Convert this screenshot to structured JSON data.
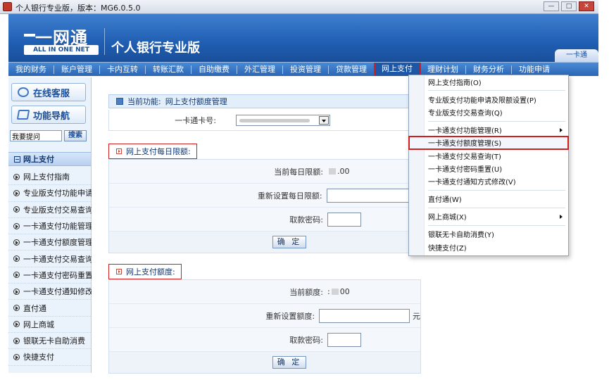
{
  "window": {
    "title": "个人银行专业版，版本：MG6.0.5.0",
    "controls": [
      "—",
      "□",
      "✕"
    ]
  },
  "header": {
    "logo_cn": "一网通",
    "logo_en": "ALL IN ONE NET",
    "product_name": "个人银行专业版",
    "shortcut_tab": "一卡通"
  },
  "nav": {
    "items": [
      "我的财务",
      "账户管理",
      "卡内互转",
      "转账汇款",
      "自助缴费",
      "外汇管理",
      "投资管理",
      "贷款管理",
      "网上支付",
      "理财计划",
      "财务分析",
      "功能申请"
    ],
    "active_index": 8
  },
  "sidebar": {
    "online_service": "在线客服",
    "function_nav": "功能导航",
    "search_placeholder": "我要提问",
    "search_button": "搜索",
    "section_title": "网上支付",
    "section_toggle": "−",
    "items": [
      "网上支付指南",
      "专业版支付功能申请",
      "专业版支付交易查询",
      "一卡通支付功能管理",
      "一卡通支付额度管理",
      "一卡通支付交易查询",
      "一卡通支付密码重置",
      "一卡通支付通知修改",
      "直付通",
      "网上商城",
      "银联无卡自助消费",
      "快捷支付"
    ]
  },
  "main": {
    "breadcrumb_label": "当前功能:",
    "breadcrumb_value": "网上支付额度管理",
    "card_label": "一卡通卡号:",
    "daily": {
      "title": "网上支付每日限额:",
      "current_label": "当前每日限额:",
      "current_prefix": "",
      "current_value": ".00",
      "reset_label": "重新设置每日限额:",
      "password_label": "取款密码:",
      "confirm": "确 定"
    },
    "quota": {
      "title": "网上支付额度:",
      "current_label": "当前额度:",
      "current_prefix": ":",
      "current_value": "00",
      "reset_label": "重新设置额度:",
      "unit": "元",
      "password_label": "取款密码:",
      "confirm": "确 定"
    }
  },
  "menu": {
    "groups": [
      [
        {
          "label": "网上支付指南(O)"
        }
      ],
      [
        {
          "label": "专业版支付功能申请及限额设置(P)"
        },
        {
          "label": "专业版支付交易查询(Q)"
        }
      ],
      [
        {
          "label": "一卡通支付功能管理(R)",
          "submenu": true
        },
        {
          "label": "一卡通支付额度管理(S)",
          "highlight": true
        },
        {
          "label": "一卡通支付交易查询(T)"
        },
        {
          "label": "一卡通支付密码重置(U)"
        },
        {
          "label": "一卡通支付通知方式修改(V)"
        }
      ],
      [
        {
          "label": "直付通(W)"
        }
      ],
      [
        {
          "label": "网上商城(X)",
          "submenu": true
        }
      ],
      [
        {
          "label": "银联无卡自助消费(Y)"
        },
        {
          "label": "快捷支付(Z)"
        }
      ]
    ]
  },
  "colors": {
    "header_blue": "#1f5eb2",
    "nav_blue": "#2a66b6",
    "highlight_red": "#d11f1f",
    "sidebar_bg": "#eaf2fc"
  }
}
